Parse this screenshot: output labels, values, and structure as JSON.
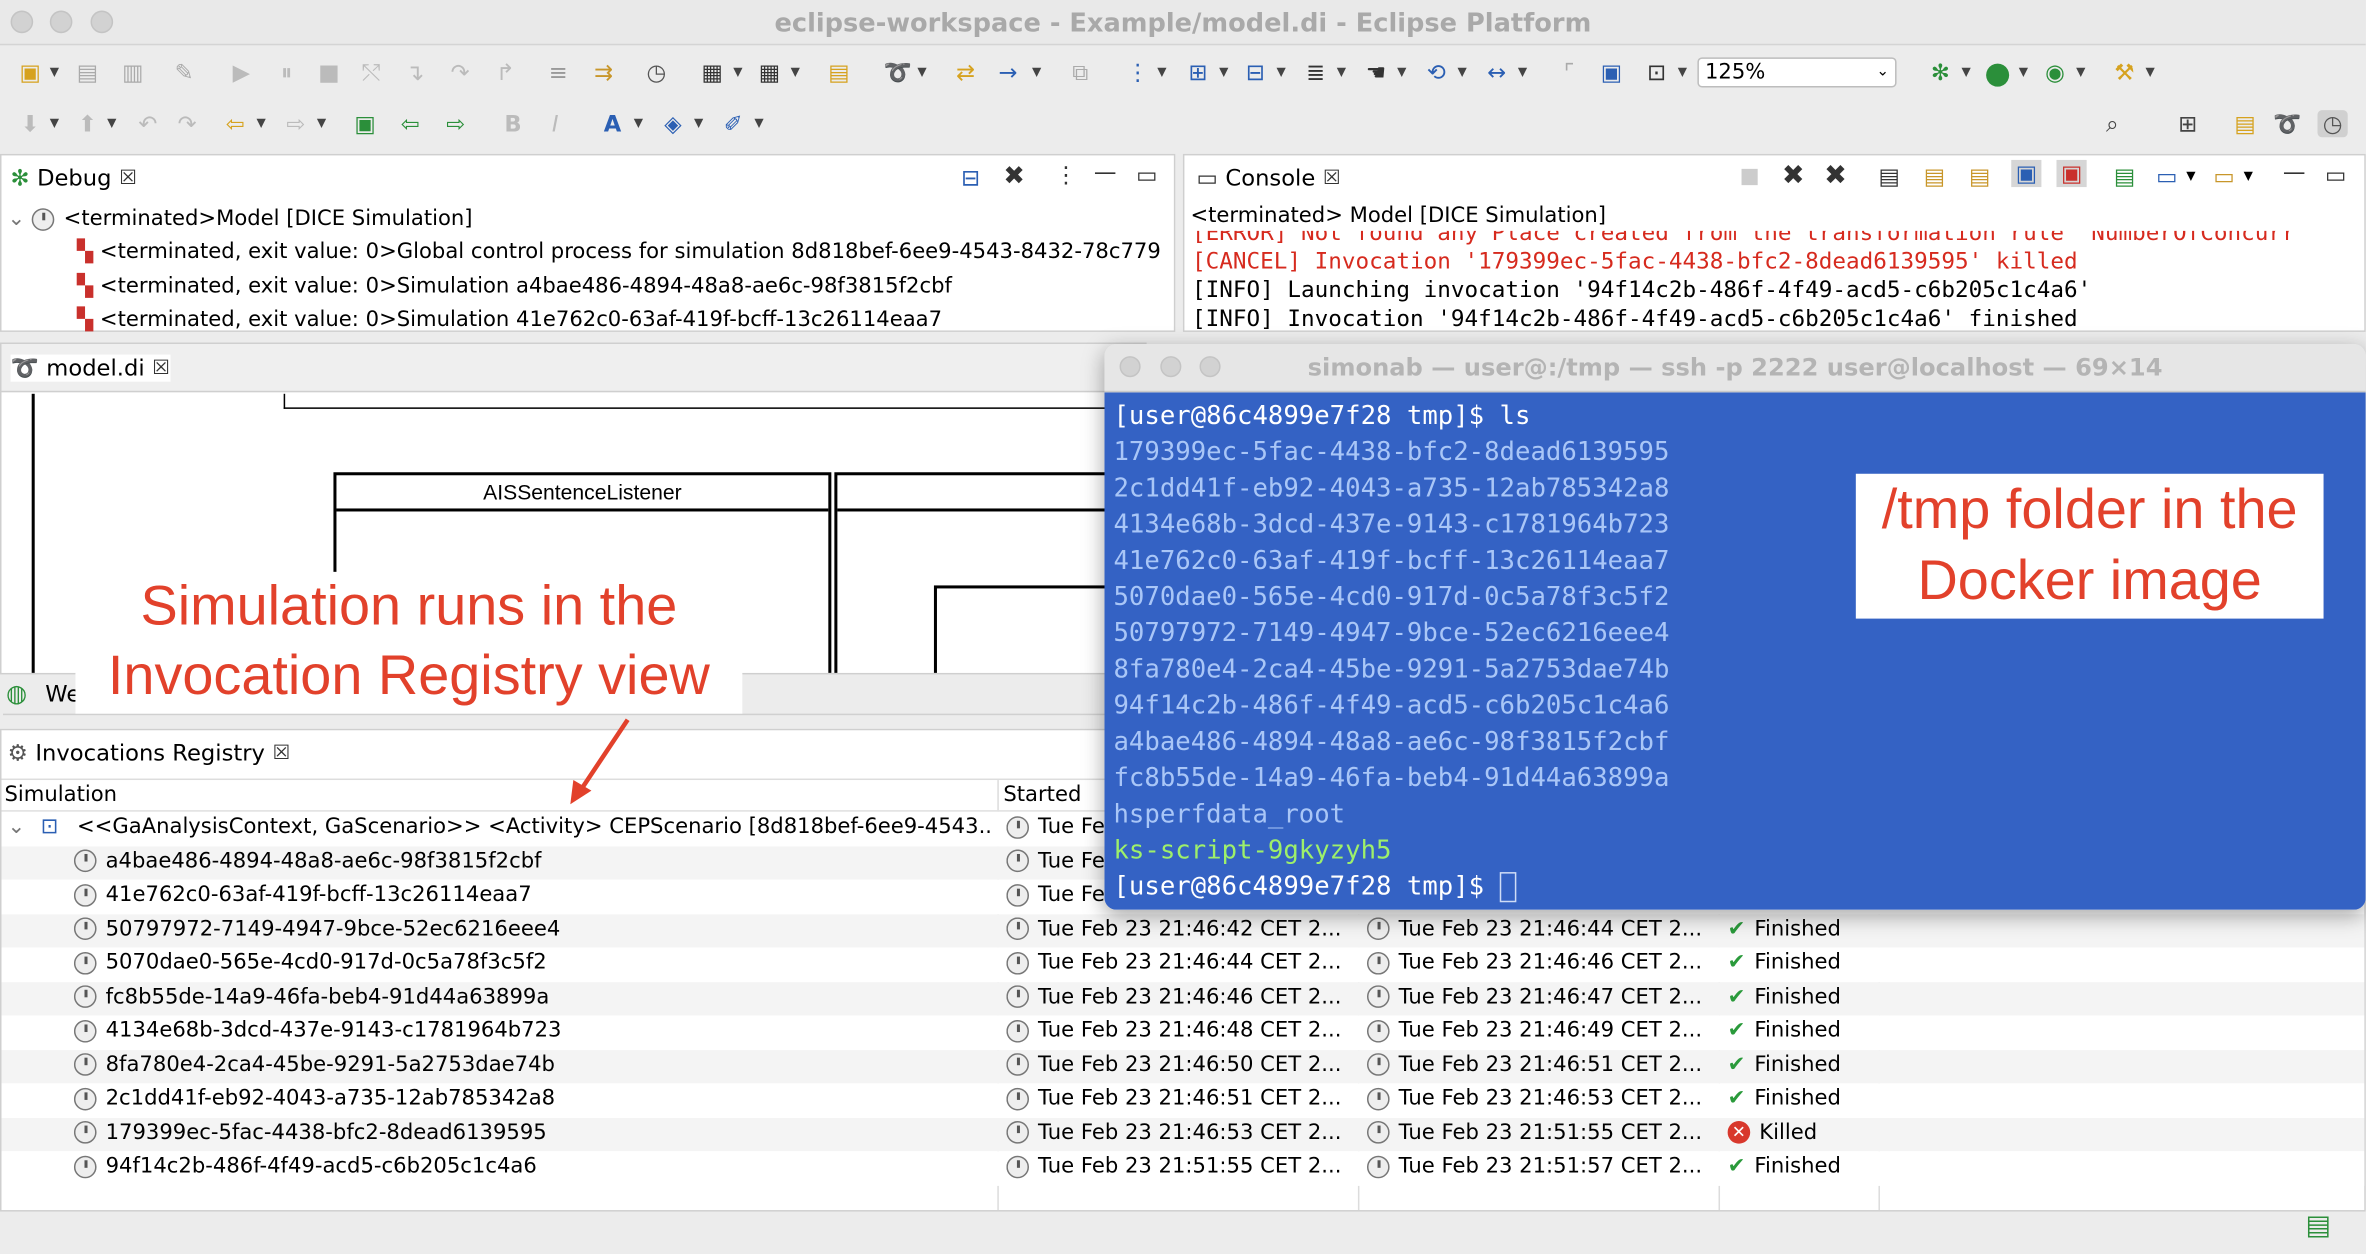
{
  "window": {
    "title": "eclipse-workspace - Example/model.di - Eclipse Platform"
  },
  "toolbar": {
    "zoom": "125%"
  },
  "debug": {
    "tab": "Debug",
    "root": "<terminated>Model [DICE Simulation]",
    "items": [
      "<terminated, exit value: 0>Global control process for simulation 8d818bef-6ee9-4543-8432-78c779",
      "<terminated, exit value: 0>Simulation a4bae486-4894-48a8-ae6c-98f3815f2cbf",
      "<terminated, exit value: 0>Simulation 41e762c0-63af-419f-bcff-13c26114eaa7"
    ]
  },
  "console": {
    "tab": "Console",
    "header": "<terminated> Model [DICE Simulation]",
    "lines": [
      {
        "text": "[ERROR] Not found any Place created from the transformation rule 'NumberOfConcurr",
        "color": "#d62a1e"
      },
      {
        "text": "[CANCEL] Invocation '179399ec-5fac-4438-bfc2-8dead6139595' killed",
        "color": "#d62a1e"
      },
      {
        "text": "[INFO] Launching invocation '94f14c2b-486f-4f49-acd5-c6b205c1c4a6'",
        "color": "#000000"
      },
      {
        "text": "[INFO] Invocation '94f14c2b-486f-4f49-acd5-c6b205c1c4a6' finished",
        "color": "#000000"
      }
    ]
  },
  "editor": {
    "tab": "model.di",
    "class_label": "AISSentenceListener",
    "hidden_tab_stub": "We"
  },
  "terminal": {
    "title": "simonab — user@:/tmp — ssh -p 2222 user@localhost — 69×14",
    "prompt_cmd": "[user@86c4899e7f28 tmp]$ ls",
    "entries": [
      "179399ec-5fac-4438-bfc2-8dead6139595",
      "2c1dd41f-eb92-4043-a735-12ab785342a8",
      "4134e68b-3dcd-437e-9143-c1781964b723",
      "41e762c0-63af-419f-bcff-13c26114eaa7",
      "5070dae0-565e-4cd0-917d-0c5a78f3c5f2",
      "50797972-7149-4947-9bce-52ec6216eee4",
      "8fa780e4-2ca4-45be-9291-5a2753dae74b",
      "94f14c2b-486f-4f49-acd5-c6b205c1c4a6",
      "a4bae486-4894-48a8-ae6c-98f3815f2cbf",
      "fc8b55de-14a9-46fa-beb4-91d44a63899a",
      "hsperfdata_root"
    ],
    "script_entry": "ks-script-9gkyzyh5",
    "prompt_end": "[user@86c4899e7f28 tmp]$ "
  },
  "notes": {
    "left": [
      "Simulation runs in the",
      "Invocation Registry view"
    ],
    "right": [
      "/tmp folder in the",
      "Docker image"
    ]
  },
  "registry": {
    "tab": "Invocations Registry",
    "col_simulation": "Simulation",
    "col_started": "Started",
    "root": "<<GaAnalysisContext, GaScenario>> <Activity> CEPScenario [8d818bef-6ee9-4543...",
    "root_started": "Tue Fe",
    "rows": [
      {
        "id": "a4bae486-4894-48a8-ae6c-98f3815f2cbf",
        "started": "Tue Fe",
        "ended": "",
        "status": "",
        "state": "none"
      },
      {
        "id": "41e762c0-63af-419f-bcff-13c26114eaa7",
        "started": "Tue Fe",
        "ended": "",
        "status": "",
        "state": "none"
      },
      {
        "id": "50797972-7149-4947-9bce-52ec6216eee4",
        "started": "Tue Feb 23 21:46:42 CET 2...",
        "ended": "Tue Feb 23 21:46:44 CET 2...",
        "status": "Finished",
        "state": "ok"
      },
      {
        "id": "5070dae0-565e-4cd0-917d-0c5a78f3c5f2",
        "started": "Tue Feb 23 21:46:44 CET 2...",
        "ended": "Tue Feb 23 21:46:46 CET 2...",
        "status": "Finished",
        "state": "ok"
      },
      {
        "id": "fc8b55de-14a9-46fa-beb4-91d44a63899a",
        "started": "Tue Feb 23 21:46:46 CET 2...",
        "ended": "Tue Feb 23 21:46:47 CET 2...",
        "status": "Finished",
        "state": "ok"
      },
      {
        "id": "4134e68b-3dcd-437e-9143-c1781964b723",
        "started": "Tue Feb 23 21:46:48 CET 2...",
        "ended": "Tue Feb 23 21:46:49 CET 2...",
        "status": "Finished",
        "state": "ok"
      },
      {
        "id": "8fa780e4-2ca4-45be-9291-5a2753dae74b",
        "started": "Tue Feb 23 21:46:50 CET 2...",
        "ended": "Tue Feb 23 21:46:51 CET 2...",
        "status": "Finished",
        "state": "ok"
      },
      {
        "id": "2c1dd41f-eb92-4043-a735-12ab785342a8",
        "started": "Tue Feb 23 21:46:51 CET 2...",
        "ended": "Tue Feb 23 21:46:53 CET 2...",
        "status": "Finished",
        "state": "ok"
      },
      {
        "id": "179399ec-5fac-4438-bfc2-8dead6139595",
        "started": "Tue Feb 23 21:46:53 CET 2...",
        "ended": "Tue Feb 23 21:51:55 CET 2...",
        "status": "Killed",
        "state": "killed"
      },
      {
        "id": "94f14c2b-486f-4f49-acd5-c6b205c1c4a6",
        "started": "Tue Feb 23 21:51:55 CET 2...",
        "ended": "Tue Feb 23 21:51:57 CET 2...",
        "status": "Finished",
        "state": "ok"
      }
    ]
  },
  "colors": {
    "terminal_bg": "#3462c4",
    "terminal_text": "#a9c6f7",
    "terminal_green": "#9ef06a",
    "annotation_red": "#e2412b",
    "error_red": "#d62a1e"
  }
}
